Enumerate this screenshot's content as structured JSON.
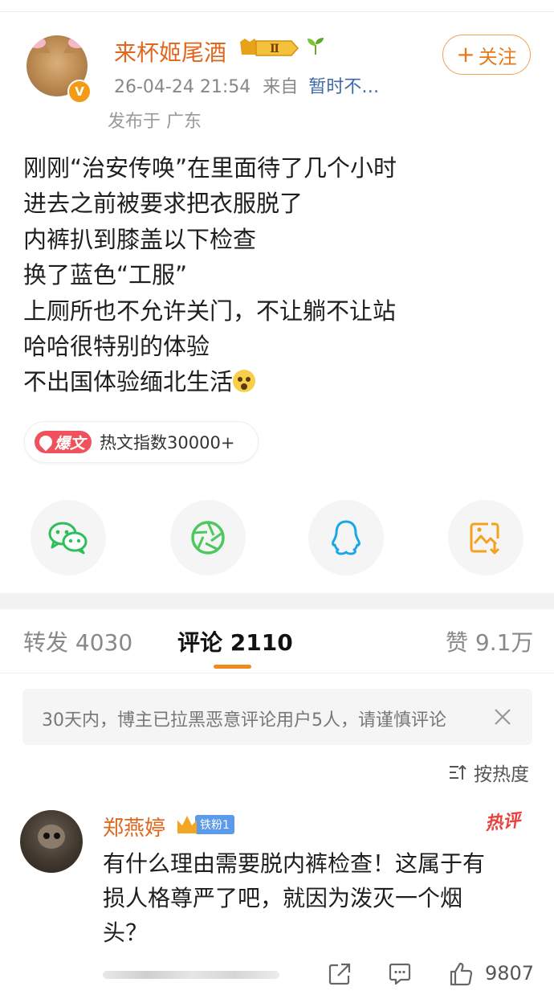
{
  "post": {
    "author": "来杯姬尾酒",
    "level_badge": "Ⅱ",
    "meta_time": "26-04-24 21:54",
    "meta_from": "来自",
    "meta_source": "暂时不…",
    "location": "发布于 广东",
    "follow_label": "关注",
    "lines": [
      "刚刚“治安传唤”在里面待了几个小时",
      "进去之前被要求把衣服脱了",
      "内裤扒到膝盖以下检查",
      "换了蓝色“工服”",
      "上厕所也不允许关门，不让躺不让站",
      "哈哈很特别的体验",
      "不出国体验缅北生活"
    ],
    "hot_tag": "爆文",
    "hot_index": "热文指数30000+"
  },
  "share": {
    "items": [
      "wechat-icon",
      "moments-icon",
      "qq-icon",
      "save-image-icon"
    ],
    "colors": {
      "wechat": "#2fbf5a",
      "moments": "#4cc85f",
      "qq": "#1aa7e8",
      "save": "#f3a21c"
    }
  },
  "tabs": {
    "repost": "转发 4030",
    "comments": "评论 2110",
    "likes": "赞 9.1万"
  },
  "notice": {
    "text": "30天内，博主已拉黑恶意评论用户5人，请谨慎评论"
  },
  "sort": {
    "label": "按热度"
  },
  "comment": {
    "author": "郑燕婷",
    "fan_badge": "铁粉1",
    "hot_stamp": "热评",
    "lines": [
      "有什么理由需要脱内裤检查！这属于有",
      "损人格尊严了吧，就因为泼灭一个烟",
      "头？"
    ],
    "like_count": "9807"
  },
  "colors": {
    "accent_orange": "#e0661d",
    "link_blue": "#3d6aa8",
    "tab_underline": "#f08a1c"
  }
}
